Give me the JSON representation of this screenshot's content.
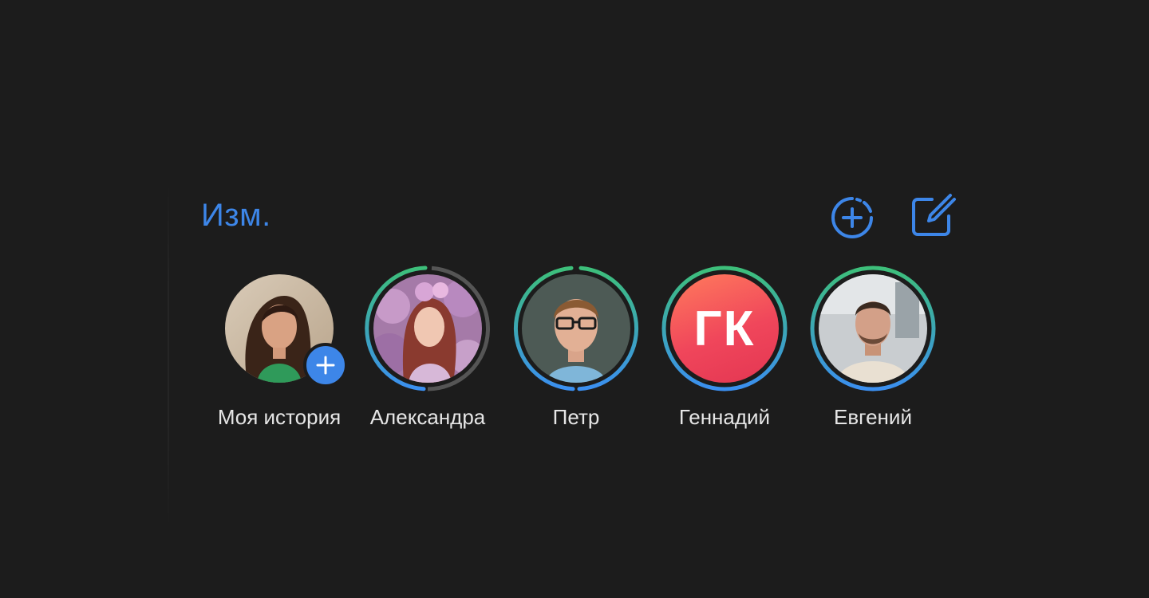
{
  "header": {
    "edit_label": "Изм.",
    "add_story_icon": "add-circle-dashed-icon",
    "compose_icon": "compose-icon",
    "accent_color": "#3d86e8"
  },
  "stories": [
    {
      "name": "Моя история",
      "ring": "none",
      "badge": "plus-icon"
    },
    {
      "name": "Александра",
      "ring": "gradient-segmented",
      "segments": 2
    },
    {
      "name": "Петр",
      "ring": "gradient-segmented",
      "segments": 2
    },
    {
      "name": "Геннадий",
      "ring": "gradient",
      "initials": "ГК"
    },
    {
      "name": "Евгений",
      "ring": "gradient"
    }
  ],
  "colors": {
    "background": "#1c1c1c",
    "ring_top": "#3dbf7a",
    "ring_bottom": "#3b8ff0",
    "initials_bg": "#f0465b"
  }
}
